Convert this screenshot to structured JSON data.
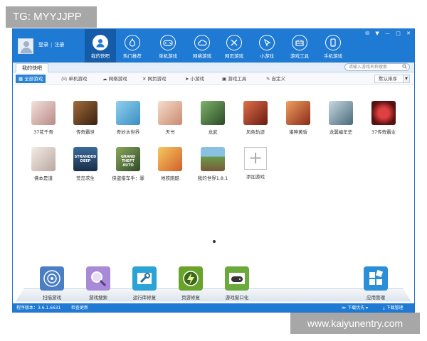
{
  "watermark": {
    "top": "TG: MYYJJPP",
    "bottom": "www.kaiyunentry.com"
  },
  "header": {
    "login": "登录",
    "register": "注册",
    "nav": [
      {
        "label": "我的快吧",
        "icon": "user-icon"
      },
      {
        "label": "热门推荐",
        "icon": "flame-icon"
      },
      {
        "label": "单机游戏",
        "icon": "gamepad-icon"
      },
      {
        "label": "网络游戏",
        "icon": "cloud-icon"
      },
      {
        "label": "网页游戏",
        "icon": "crossed-swords-icon"
      },
      {
        "label": "小游戏",
        "icon": "cursor-icon"
      },
      {
        "label": "游戏工具",
        "icon": "toolbox-icon"
      },
      {
        "label": "手机游戏",
        "icon": "phone-icon"
      }
    ],
    "controls": [
      "✉",
      "▼",
      "—",
      "□",
      "✕"
    ]
  },
  "tabbar": {
    "tab": "我的快吧",
    "search_placeholder": "请输入游戏名称搜索"
  },
  "filters": {
    "items": [
      {
        "label": "全部游戏",
        "icon": "grid-icon",
        "active": true
      },
      {
        "label": "单机游戏",
        "icon": "gamepad-icon",
        "active": false
      },
      {
        "label": "网络游戏",
        "icon": "cloud-icon",
        "active": false
      },
      {
        "label": "网页游戏",
        "icon": "crossed-swords-icon",
        "active": false
      },
      {
        "label": "小游戏",
        "icon": "cursor-icon",
        "active": false
      },
      {
        "label": "游戏工具",
        "icon": "toolbox-icon",
        "active": false
      },
      {
        "label": "自定义",
        "icon": "pencil-icon",
        "active": false
      }
    ],
    "sort": "默认排序"
  },
  "games": [
    {
      "name": "37花千骨",
      "color": "#c9a6a0"
    },
    {
      "name": "传奇霸世",
      "color": "#7a4a2a"
    },
    {
      "name": "奇妙水世界",
      "color": "#5aa9d6"
    },
    {
      "name": "天书",
      "color": "#e6b8a0"
    },
    {
      "name": "龙武",
      "color": "#3e6e3a"
    },
    {
      "name": "风色轨迹",
      "color": "#b0402c"
    },
    {
      "name": "诸神黄昏",
      "color": "#c55a2e"
    },
    {
      "name": "龙翼编年史",
      "color": "#6f8a9a"
    },
    {
      "name": "37传奇霸业",
      "color": "#8a1e1e"
    },
    {
      "name": "佛本是道",
      "color": "#d8c9c0"
    },
    {
      "name": "荒岛求生",
      "color": "#2b4f7a",
      "caption": "STRANDED DEEP"
    },
    {
      "name": "侠盗猎车手：罪",
      "color": "#3d6a3a",
      "caption": "GRAND THEFT AUTO"
    },
    {
      "name": "地铁跑酷",
      "color": "#e6a13a"
    },
    {
      "name": "我的世界1.8.1",
      "color": "#6a9a4a"
    },
    {
      "name": "添加游戏",
      "color": "#ffffff"
    }
  ],
  "tools": [
    {
      "label": "扫描游戏",
      "color": "#4a7fc6",
      "icon": "radar-icon"
    },
    {
      "label": "游戏搜索",
      "color": "#a88ad6",
      "icon": "magnifier-icon"
    },
    {
      "label": "运行库修复",
      "color": "#2aa3d6",
      "icon": "wrench-icon"
    },
    {
      "label": "页游修复",
      "color": "#6aa32a",
      "icon": "bolt-icon"
    },
    {
      "label": "游戏窗口化",
      "color": "#6aaa3a",
      "icon": "gamepad-icon"
    },
    {
      "label": "应用管理",
      "color": "#2a8fd6",
      "icon": "apps-grid-icon"
    }
  ],
  "status": {
    "version": "程序版本：3.6.1.6631",
    "update": "检查更新",
    "download_priority": "下载优先",
    "download_manager": "下载管理"
  }
}
